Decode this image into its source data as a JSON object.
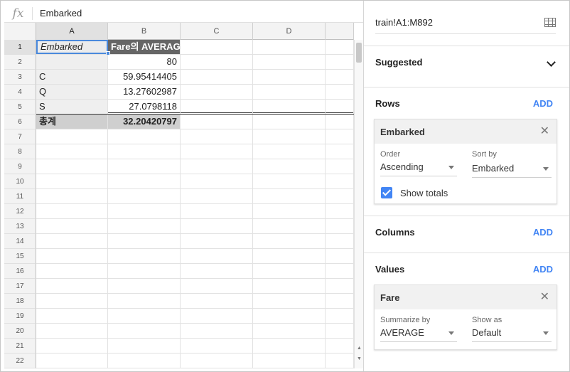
{
  "formula_bar": {
    "icon": "fx",
    "value": "Embarked"
  },
  "columns": [
    "A",
    "B",
    "C",
    "D"
  ],
  "row_numbers": [
    "1",
    "2",
    "3",
    "4",
    "5",
    "6",
    "7",
    "8",
    "9",
    "10",
    "11",
    "12",
    "13",
    "14",
    "15",
    "16",
    "17",
    "18",
    "19",
    "20",
    "21",
    "22"
  ],
  "table": {
    "header": {
      "a": "Embarked",
      "b": "Fare의 AVERAGE"
    },
    "rows": [
      {
        "a": "",
        "b": "80"
      },
      {
        "a": "C",
        "b": "59.95414405"
      },
      {
        "a": "Q",
        "b": "13.27602987"
      },
      {
        "a": "S",
        "b": "27.0798118"
      }
    ],
    "totals": {
      "a": "총계",
      "b": "32.20420797"
    }
  },
  "editor": {
    "range": "train!A1:M892",
    "suggested": {
      "title": "Suggested"
    },
    "rows": {
      "title": "Rows",
      "add": "ADD",
      "card": {
        "title": "Embarked",
        "order_label": "Order",
        "order_value": "Ascending",
        "sortby_label": "Sort by",
        "sortby_value": "Embarked",
        "show_totals_label": "Show totals",
        "show_totals_checked": true
      }
    },
    "columns": {
      "title": "Columns",
      "add": "ADD"
    },
    "values": {
      "title": "Values",
      "add": "ADD",
      "card": {
        "title": "Fare",
        "summarize_label": "Summarize by",
        "summarize_value": "AVERAGE",
        "showas_label": "Show as",
        "showas_value": "Default"
      }
    }
  },
  "colors": {
    "accent": "#4285f4",
    "selection": "#4a89dc",
    "pivot_header": "#666666",
    "totals": "#cfcfcf"
  }
}
